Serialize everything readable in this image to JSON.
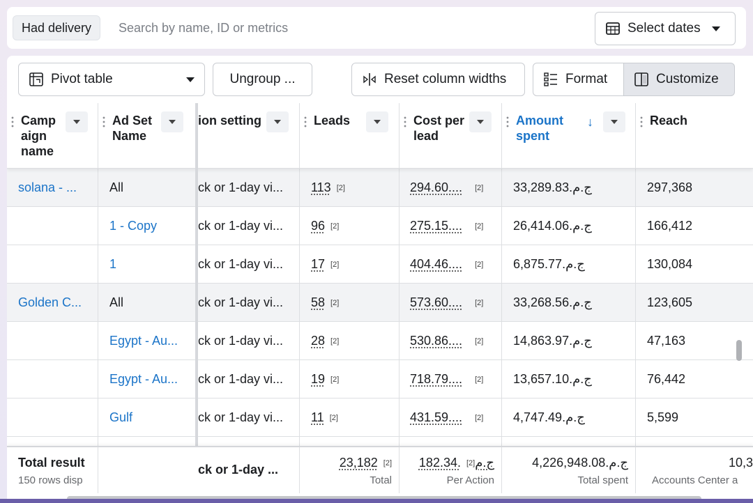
{
  "filter": {
    "chip": "Had delivery",
    "search_placeholder": "Search by name, ID or metrics",
    "dates_label": "Select dates"
  },
  "toolbar": {
    "pivot": "Pivot table",
    "ungroup": "Ungroup ...",
    "reset": "Reset column widths",
    "format": "Format",
    "customize": "Customize"
  },
  "headers": {
    "campaign": [
      "Camp",
      "aign",
      "name"
    ],
    "adset": [
      "Ad Set",
      "Name"
    ],
    "attribution": "ion setting",
    "leads": "Leads",
    "cpl": [
      "Cost per",
      "lead"
    ],
    "amount": [
      "Amount",
      "spent"
    ],
    "amount_sort": "↓",
    "reach": "Reach"
  },
  "rows": [
    {
      "campaign": "solana - ...",
      "adset": "All",
      "adset_link": false,
      "attr": "ck or 1-day vi...",
      "leads": "113",
      "leads_n": "[2]",
      "cpl": "294.60....",
      "cpl_n": "[2]",
      "amount": "33,289.83.ج.م",
      "reach": "297,368",
      "shaded": true
    },
    {
      "campaign": "",
      "adset": "1 - Copy",
      "adset_link": true,
      "attr": "ck or 1-day vi...",
      "leads": "96",
      "leads_n": "[2]",
      "cpl": "275.15....",
      "cpl_n": "[2]",
      "amount": "26,414.06.ج.م",
      "reach": "166,412",
      "shaded": false
    },
    {
      "campaign": "",
      "adset": "1",
      "adset_link": true,
      "attr": "ck or 1-day vi...",
      "leads": "17",
      "leads_n": "[2]",
      "cpl": "404.46....",
      "cpl_n": "[2]",
      "amount": "6,875.77.ج.م",
      "reach": "130,084",
      "shaded": false
    },
    {
      "campaign": "Golden C...",
      "adset": "All",
      "adset_link": false,
      "attr": "ck or 1-day vi...",
      "leads": "58",
      "leads_n": "[2]",
      "cpl": "573.60....",
      "cpl_n": "[2]",
      "amount": "33,268.56.ج.م",
      "reach": "123,605",
      "shaded": true
    },
    {
      "campaign": "",
      "adset": "Egypt - Au...",
      "adset_link": true,
      "attr": "ck or 1-day vi...",
      "leads": "28",
      "leads_n": "[2]",
      "cpl": "530.86....",
      "cpl_n": "[2]",
      "amount": "14,863.97.ج.م",
      "reach": "47,163",
      "shaded": false
    },
    {
      "campaign": "",
      "adset": "Egypt - Au...",
      "adset_link": true,
      "attr": "ck or 1-day vi...",
      "leads": "19",
      "leads_n": "[2]",
      "cpl": "718.79....",
      "cpl_n": "[2]",
      "amount": "13,657.10.ج.م",
      "reach": "76,442",
      "shaded": false
    },
    {
      "campaign": "",
      "adset": "Gulf",
      "adset_link": true,
      "attr": "ck or 1-day vi...",
      "leads": "11",
      "leads_n": "[2]",
      "cpl": "431.59....",
      "cpl_n": "[2]",
      "amount": "4,747.49.ج.م",
      "reach": "5,599",
      "shaded": false
    }
  ],
  "totals": {
    "title": "Total result",
    "subtitle": "150 rows disp",
    "attr": "ck or 1-day ...",
    "leads": "23,182",
    "leads_n": "[2]",
    "leads_sub": "Total",
    "cpl": "182.34.ج.م",
    "cpl_n": "[2]",
    "cpl_sub": "Per Action",
    "amount": "4,226,948.08.ج.م",
    "amount_sub": "Total spent",
    "reach": "10,3",
    "reach_sub": "Accounts Center a"
  },
  "colors": {
    "link": "#1b74c8",
    "shaded_row": "#f2f3f5",
    "border": "#dddfe2"
  },
  "icons": {
    "dates": "calendar-table-icon",
    "pivot": "pivot-icon",
    "reset": "column-resize-icon",
    "format": "format-list-icon",
    "customize": "columns-panel-icon"
  }
}
